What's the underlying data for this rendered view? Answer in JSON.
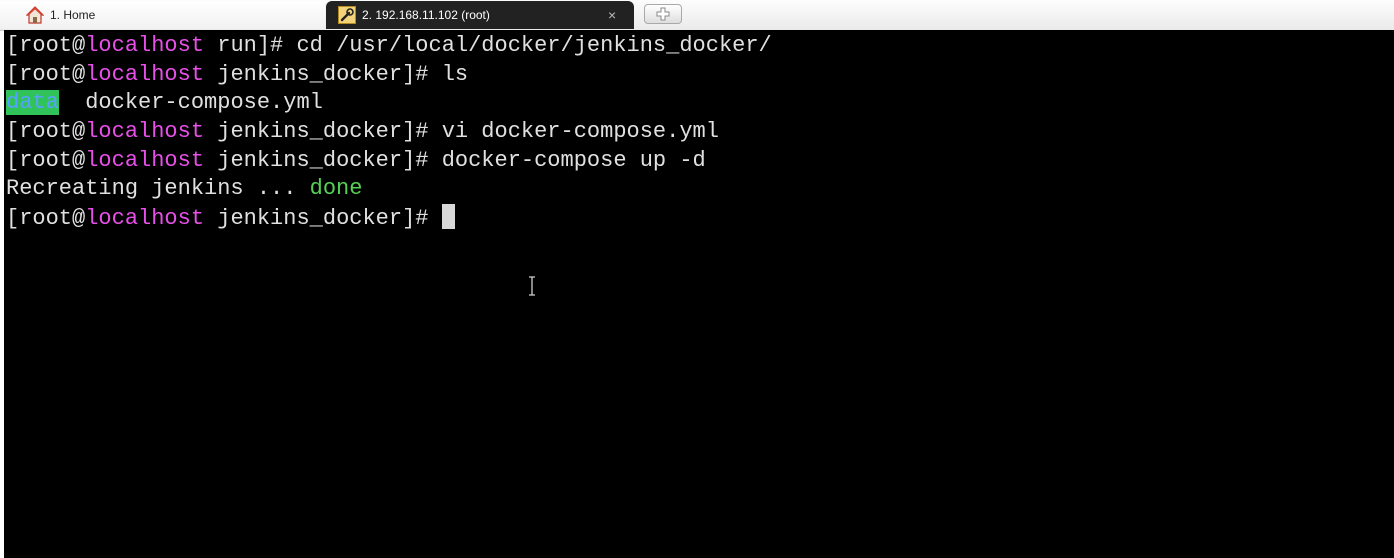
{
  "tabs": [
    {
      "label": "1. Home",
      "icon": "home-icon",
      "active": false
    },
    {
      "label": "2. 192.168.11.102 (root)",
      "icon": "wrench-icon",
      "active": true
    }
  ],
  "tab_close_symbol": "×",
  "new_tab_icon": "add-tab-icon",
  "prompt": {
    "open": "[root@",
    "host": "localhost",
    "cwd_run": " run]# ",
    "cwd_jenkins": " jenkins_docker]# "
  },
  "lines": [
    {
      "command": "cd /usr/local/docker/jenkins_docker/"
    },
    {
      "command": "ls"
    },
    {
      "dir": "data",
      "file": "  docker-compose.yml"
    },
    {
      "command": "vi docker-compose.yml"
    },
    {
      "command": "docker-compose up -d"
    },
    {
      "text": "Recreating jenkins ... ",
      "status": "done"
    }
  ],
  "colors": {
    "background": "#000000",
    "text": "#e0e0e0",
    "hostname": "#e84ee8",
    "status_done": "#55d055",
    "dir_highlight": "#2fc35a",
    "active_tab": "#222222"
  }
}
